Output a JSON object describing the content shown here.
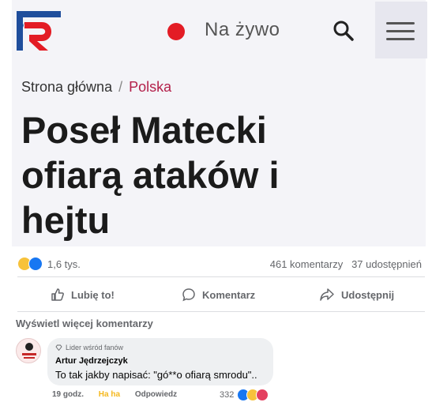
{
  "article": {
    "live_label": "Na żywo",
    "breadcrumb": {
      "home": "Strona główna",
      "separator": "/",
      "category": "Polska"
    },
    "headline_lines": [
      "Poseł Matecki",
      "ofiarą ataków i",
      "hejtu"
    ],
    "colors": {
      "brand_red": "#e31c25",
      "brand_blue": "#1f4e9c",
      "category": "#b3204a"
    }
  },
  "post": {
    "reaction_count": "1,6 tys.",
    "comments_count": "461 komentarzy",
    "shares_count": "37 udostępnień",
    "actions": {
      "like": "Lubię to!",
      "comment": "Komentarz",
      "share": "Udostępnij"
    }
  },
  "comments": {
    "view_more": "Wyświetl więcej komentarzy",
    "items": [
      {
        "badge": "Lider wśród fanów",
        "author": "Artur Jędrzejczyk",
        "text": "To tak jakby napisać: \"gó**o ofiarą smrodu\"..",
        "time": "19 godz.",
        "reaction_label": "Ha ha",
        "reply_label": "Odpowiedz",
        "reaction_count": "332"
      }
    ]
  }
}
